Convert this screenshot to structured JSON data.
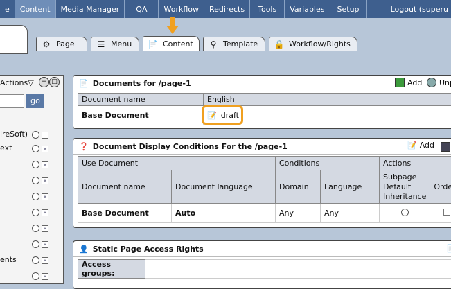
{
  "menu": {
    "items": [
      {
        "label": "e"
      },
      {
        "label": "Content"
      },
      {
        "label": "Media Manager"
      },
      {
        "label": "QA"
      },
      {
        "label": "Workflow"
      },
      {
        "label": "Redirects"
      },
      {
        "label": "Tools"
      },
      {
        "label": "Variables"
      },
      {
        "label": "Setup"
      }
    ],
    "logout": "Logout (superu"
  },
  "tabs": [
    {
      "label": "Page",
      "icon": "page-icon"
    },
    {
      "label": "Menu",
      "icon": "menu-icon"
    },
    {
      "label": "Content",
      "icon": "content-icon"
    },
    {
      "label": "Template",
      "icon": "template-icon"
    },
    {
      "label": "Workflow/Rights",
      "icon": "workflow-icon"
    }
  ],
  "left": {
    "actions": "Actions",
    "go": "go",
    "rows": [
      "ireSoft)",
      "ext",
      "",
      "",
      "",
      "",
      "",
      "",
      "ents",
      ""
    ]
  },
  "documents": {
    "title": "Documents for /page-1",
    "add": "Add",
    "unp": "Unp",
    "col_name": "Document name",
    "col_lang": "English",
    "row_name": "Base Document",
    "status": "draft"
  },
  "conditions": {
    "title": "Document Display Conditions For the /page-1",
    "add": "Add",
    "group_use": "Use Document",
    "group_conditions": "Conditions",
    "group_actions": "Actions",
    "col_docname": "Document name",
    "col_doclang": "Document language",
    "col_domain": "Domain",
    "col_language": "Language",
    "col_inherit": "Subpage Default Inheritance",
    "col_order": "Order",
    "row": {
      "name": "Base Document",
      "lang": "Auto",
      "domain": "Any",
      "language": "Any"
    }
  },
  "access": {
    "title": "Static Page Access Rights",
    "groups_label": "Access groups:"
  },
  "colors": {
    "topbar": "#3e5f8e",
    "active_menu": "#6f8eb8",
    "highlight": "#f0a020"
  }
}
